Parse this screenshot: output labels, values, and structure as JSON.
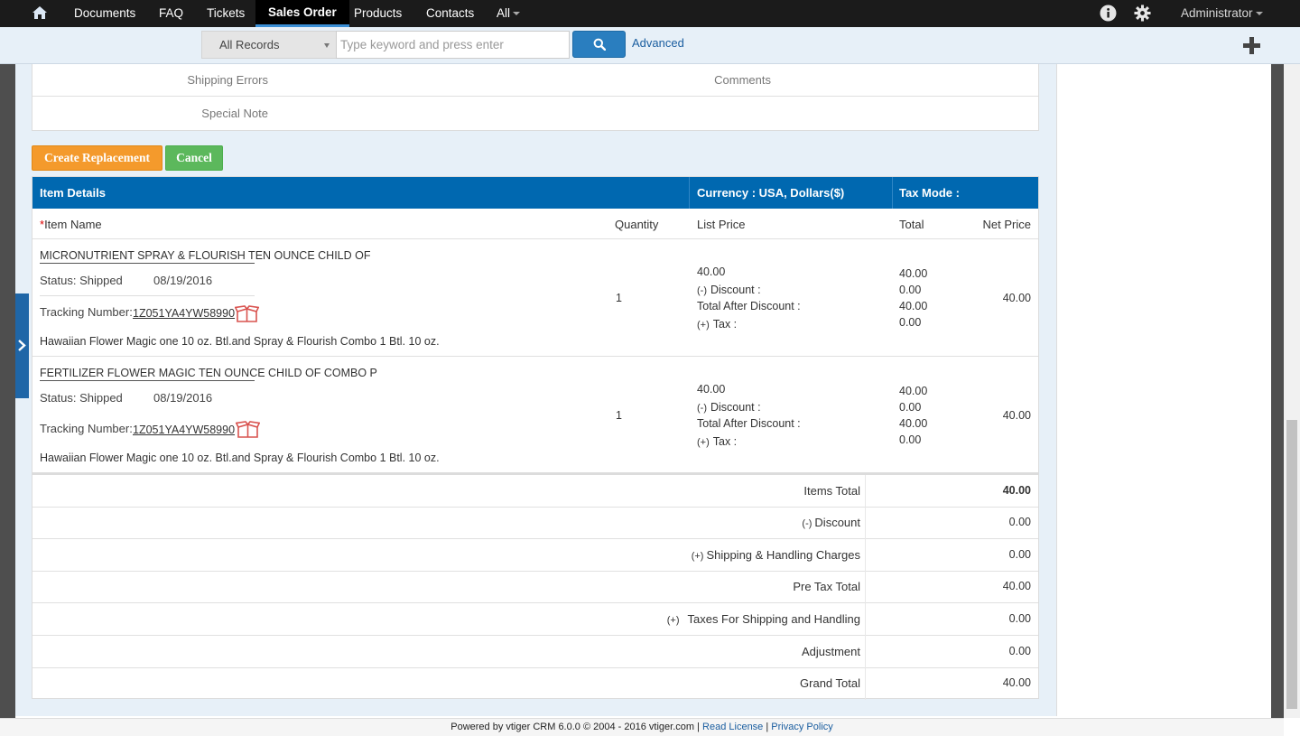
{
  "nav": {
    "items": [
      "Documents",
      "FAQ",
      "Tickets",
      "Sales Order",
      "Products",
      "Contacts",
      "All"
    ],
    "active": "Sales Order",
    "user": "Administrator"
  },
  "search": {
    "records_select": "All Records",
    "placeholder": "Type keyword and press enter",
    "advanced": "Advanced"
  },
  "form_fields": {
    "shipping_errors": "Shipping Errors",
    "comments": "Comments",
    "special_note": "Special Note"
  },
  "buttons": {
    "create_replacement": "Create Replacement",
    "cancel": "Cancel"
  },
  "items_table": {
    "header": {
      "item_details": "Item Details",
      "currency": "Currency : USA, Dollars($)",
      "tax_mode": "Tax Mode :"
    },
    "columns": {
      "req_mark": "*",
      "item_name": "Item Name",
      "quantity": "Quantity",
      "list_price": "List Price",
      "total": "Total",
      "net_price": "Net Price"
    },
    "labels": {
      "minus": "(-)",
      "plus": "(+)",
      "discount": "Discount :",
      "total_after_discount": "Total After Discount :",
      "tax": "Tax :",
      "tracking_number": "Tracking Number:"
    },
    "rows": [
      {
        "name": "MICRONUTRIENT SPRAY & FLOURISH TEN OUNCE CHILD OF",
        "status": "Status: Shipped",
        "date": "08/19/2016",
        "tracking": "1Z051YA4YW58990",
        "description": "Hawaiian Flower Magic one 10 oz. Btl.and Spray & Flourish Combo 1 Btl. 10 oz.",
        "quantity": "1",
        "list_price": "40.00",
        "total": "40.00",
        "discount": "0.00",
        "total_after_discount": "40.00",
        "tax": "0.00",
        "net_price": "40.00"
      },
      {
        "name": "FERTILIZER FLOWER MAGIC TEN OUNCE CHILD OF COMBO P",
        "status": "Status: Shipped",
        "date": "08/19/2016",
        "tracking": "1Z051YA4YW58990",
        "description": "Hawaiian Flower Magic one 10 oz. Btl.and Spray & Flourish Combo 1 Btl. 10 oz.",
        "quantity": "1",
        "list_price": "40.00",
        "total": "40.00",
        "discount": "0.00",
        "total_after_discount": "40.00",
        "tax": "0.00",
        "net_price": "40.00"
      }
    ]
  },
  "totals": {
    "items_total_label": "Items Total",
    "items_total": "40.00",
    "discount_prefix": "(-)",
    "discount_label": "Discount",
    "discount": "0.00",
    "shipping_prefix": "(+)",
    "shipping_label": "Shipping & Handling Charges",
    "shipping": "0.00",
    "pre_tax_label": "Pre Tax Total",
    "pre_tax": "40.00",
    "taxes_prefix": "(+)",
    "taxes_label": "Taxes For Shipping and Handling",
    "taxes": "0.00",
    "adjustment_label": "Adjustment",
    "adjustment": "0.00",
    "grand_total_label": "Grand Total",
    "grand_total": "40.00"
  },
  "footer": {
    "powered": "Powered by vtiger CRM 6.0.0  © 2004 - 2016",
    "site": "vtiger.com",
    "license": "Read License",
    "privacy": "Privacy Policy",
    "sep": "|"
  },
  "colors": {
    "header_blue": "#0068b0",
    "orange_button": "#f49a2c",
    "green_button": "#5cb85c",
    "box_icon": "#d9534f"
  },
  "icons": [
    "home-icon",
    "info-icon",
    "gear-icon",
    "search-icon",
    "plus-icon",
    "chevron-right-icon",
    "box-icon"
  ]
}
